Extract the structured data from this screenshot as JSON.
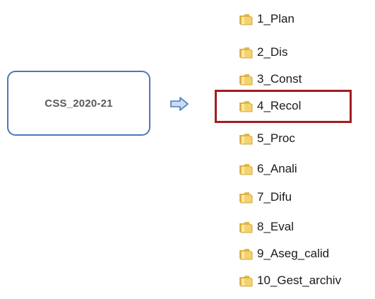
{
  "source": {
    "label": "CSS_2020-21"
  },
  "folders": [
    {
      "name": "1_Plan"
    },
    {
      "name": "2_Dis"
    },
    {
      "name": "3_Const"
    },
    {
      "name": "4_Recol",
      "highlighted": true
    },
    {
      "name": "5_Proc"
    },
    {
      "name": "6_Anali"
    },
    {
      "name": "7_Difu"
    },
    {
      "name": "8_Eval"
    },
    {
      "name": "9_Aseg_calid"
    },
    {
      "name": "10_Gest_archiv"
    }
  ],
  "colors": {
    "box_border": "#4a78b8",
    "arrow_fill": "#c9dcf2",
    "arrow_stroke": "#4a78b8",
    "highlight_border": "#a11d21",
    "folder_yellow": "#f3d36b"
  },
  "icons": {
    "folder": "folder-icon",
    "arrow": "arrow-right-icon"
  }
}
